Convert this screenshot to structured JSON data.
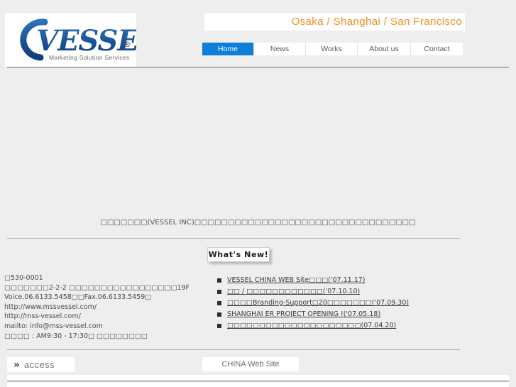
{
  "header": {
    "logo": {
      "wordmark": "VESSEL",
      "tagline": "Marketing Solution Services",
      "registered_mark": "®",
      "brand_color": "#1f5ca8"
    },
    "cities": "Osaka  /  Shanghai  /  San Francisco",
    "cities_color": "#f28f22",
    "nav": [
      {
        "label": "Home",
        "active": true
      },
      {
        "label": "News",
        "active": false
      },
      {
        "label": "Works",
        "active": false
      },
      {
        "label": "About us",
        "active": false
      },
      {
        "label": "Contact",
        "active": false
      }
    ],
    "active_tab_color": "#0d7fd8"
  },
  "main": {
    "intro": "□□□□□□□(VESSEL INC)□□□□□□□□□□□□□□□□□□□□□□□□□□□□□□□□□",
    "whats_new_label": "What's New!",
    "news": [
      {
        "text": "VESSEL CHINA WEB Site□□□('07.11.17)"
      },
      {
        "text": "□□ / □□□□□□□□□□□□('07.10.10)"
      },
      {
        "text": "□□□□Branding-Support□20□□□□□□□('07.09.30)"
      },
      {
        "text": "SHANGHAI  ER  PROJECT OPENING !('07.05.18)"
      },
      {
        "text": "□□□□□□□□□□□□□□□□□□□□□(07.04.20)"
      }
    ]
  },
  "contact": {
    "lines": [
      "□530-0001",
      "□□□□□□□2-2-2 □□□□□□□□□□□□□□□□□19F",
      "Voice.06.6133.5458□□Fax.06.6133.5459□",
      "http://www.mssvessel.com/",
      "http://mss-vessel.com/",
      "mailto: info@mss-vessel.com",
      "□□□□ : AM9:30 - 17:30□ □□□□□□□□"
    ]
  },
  "footer": {
    "access_label": "access",
    "access_chevron": "»",
    "china_label": "CHINA Web Site"
  }
}
